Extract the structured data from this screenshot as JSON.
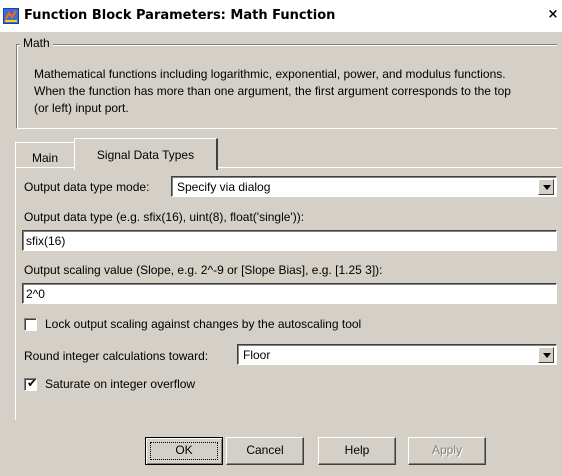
{
  "window": {
    "title": "Function Block Parameters: Math Function",
    "close_symbol": "×",
    "icon": "simulink-block-icon"
  },
  "group": {
    "legend": "Math",
    "description": "Mathematical functions including logarithmic, exponential, power, and modulus functions.  When the function has more than one argument, the first argument corresponds to the top (or left) input port."
  },
  "tabs": [
    {
      "label": "Main",
      "selected": false
    },
    {
      "label": "Signal Data Types",
      "selected": true
    }
  ],
  "form": {
    "output_mode_label": "Output data type mode:",
    "output_mode_value": "Specify via dialog",
    "output_type_label": "Output data type (e.g. sfix(16), uint(8), float('single')):",
    "output_type_value": "sfix(16)",
    "scaling_label": "Output scaling value (Slope, e.g. 2^-9 or [Slope Bias], e.g. [1.25 3]):",
    "scaling_value": "2^0",
    "lock_label": "Lock output scaling against changes by the autoscaling tool",
    "lock_checked": false,
    "round_label": "Round integer calculations toward:",
    "round_value": "Floor",
    "saturate_label": "Saturate on integer overflow",
    "saturate_checked": true,
    "checkmark": "✔"
  },
  "buttons": {
    "ok": "OK",
    "cancel": "Cancel",
    "help": "Help",
    "apply": "Apply"
  }
}
